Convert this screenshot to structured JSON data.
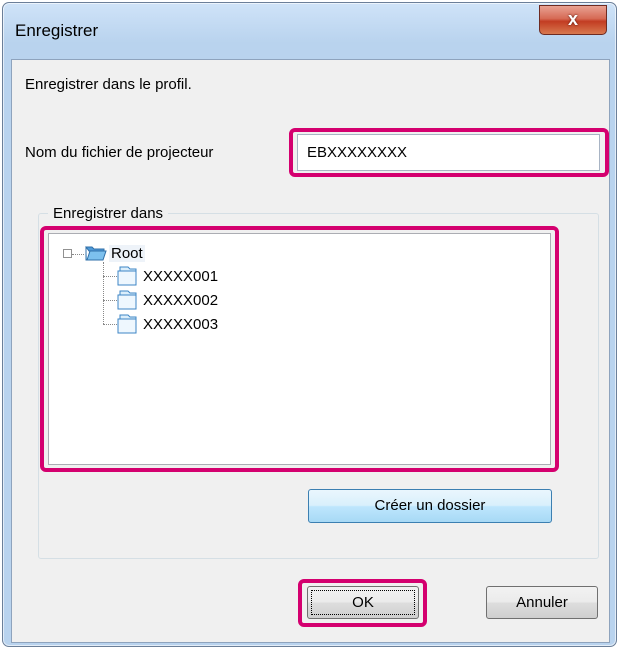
{
  "window": {
    "title": "Enregistrer",
    "close_label": "x"
  },
  "intro_text": "Enregistrer dans le profil.",
  "filename": {
    "label": "Nom du fichier de projecteur",
    "value": "EBXXXXXXXX"
  },
  "save_in": {
    "group_label": "Enregistrer dans",
    "tree": {
      "root": "Root",
      "expander": "⊟",
      "children": [
        "XXXXX001",
        "XXXXX002",
        "XXXXX003"
      ]
    },
    "create_folder_label": "Créer un dossier"
  },
  "buttons": {
    "ok_label": "OK",
    "cancel_label": "Annuler"
  },
  "colors": {
    "highlight": "#d4006f",
    "folder": "#6cb2e6"
  }
}
